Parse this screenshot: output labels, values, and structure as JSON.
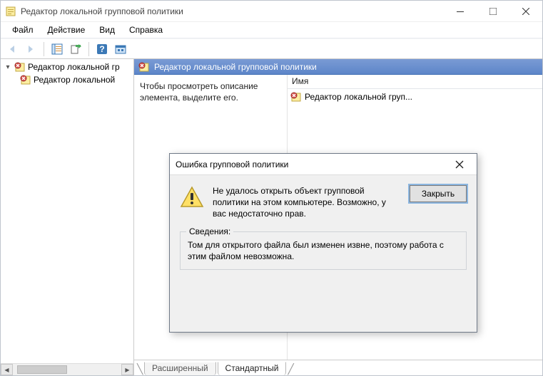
{
  "window": {
    "title": "Редактор локальной групповой политики"
  },
  "menu": {
    "file": "Файл",
    "action": "Действие",
    "view": "Вид",
    "help": "Справка"
  },
  "tree": {
    "root": "Редактор локальной гр",
    "child": "Редактор локальной"
  },
  "content": {
    "header": "Редактор локальной групповой политики",
    "hint": "Чтобы просмотреть описание элемента, выделите его.",
    "column_name": "Имя",
    "item_label": "Редактор локальной груп..."
  },
  "tabs": {
    "extended": "Расширенный",
    "standard": "Стандартный"
  },
  "dialog": {
    "title": "Ошибка групповой политики",
    "message": "Не удалось открыть объект групповой политики на этом компьютере. Возможно, у вас недостаточно прав.",
    "close_button": "Закрыть",
    "details_label": "Сведения:",
    "details_text": "Том для открытого файла был изменен извне, поэтому работа с этим файлом невозможна."
  },
  "icons": {
    "app": "gpedit-icon",
    "gp_error": "gp-error-icon",
    "back": "back-arrow-icon",
    "forward": "forward-arrow-icon",
    "shelf": "shelf-icon",
    "export": "export-icon",
    "help": "help-icon",
    "options": "options-icon",
    "warning": "warning-icon"
  }
}
